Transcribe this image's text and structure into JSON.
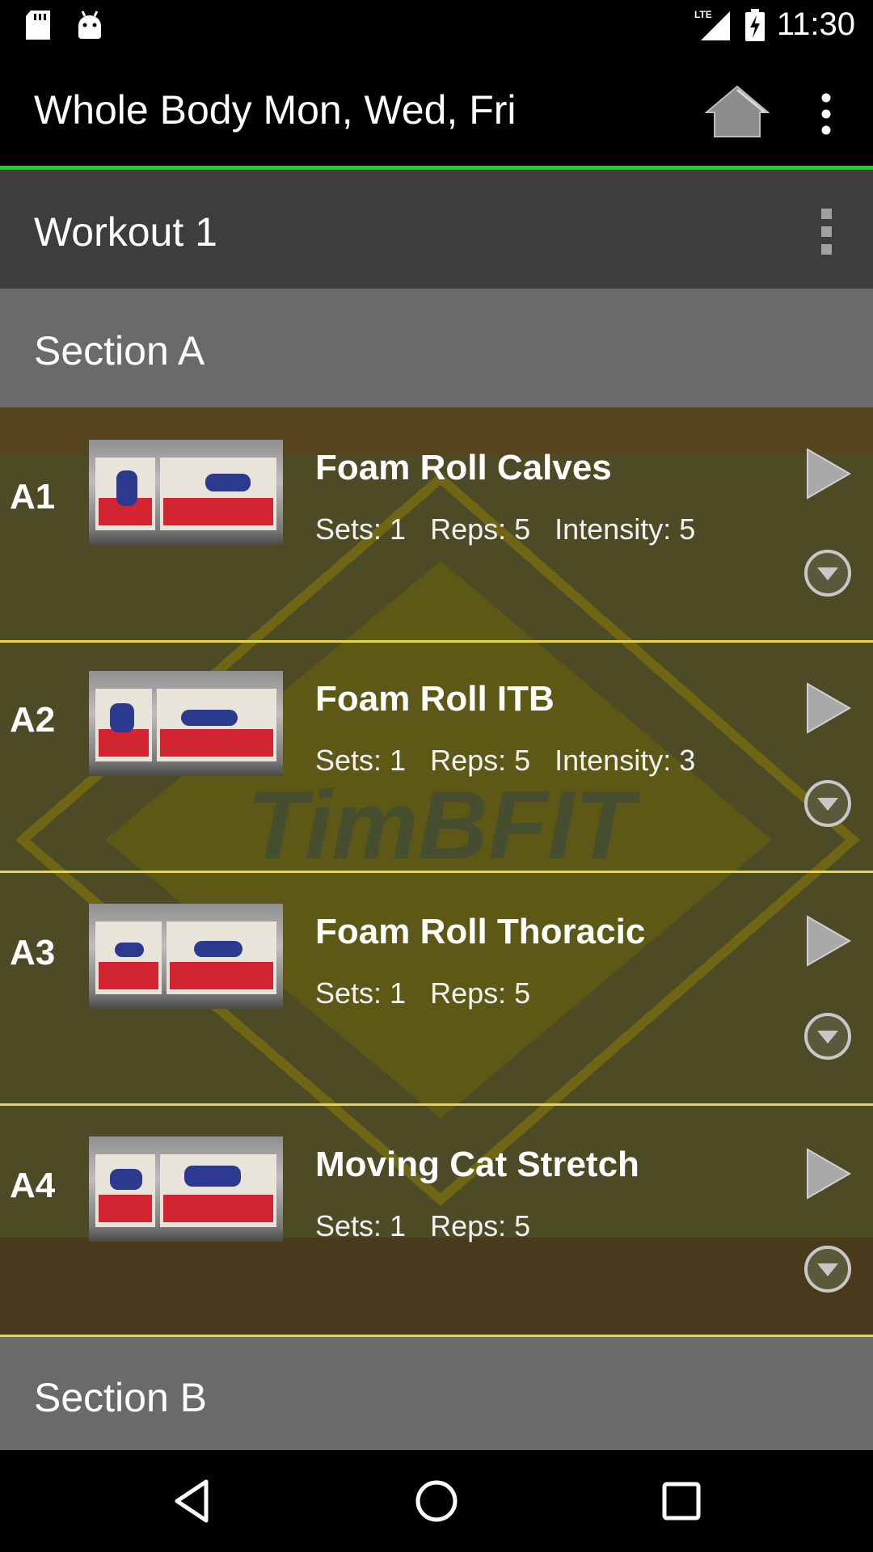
{
  "status_bar": {
    "time": "11:30",
    "network": "LTE",
    "icons": [
      "sd-card-icon",
      "android-icon",
      "lte-signal-icon",
      "battery-charging-icon"
    ]
  },
  "app_bar": {
    "title": "Whole Body Mon, Wed, Fri",
    "accent_color": "#11dd11"
  },
  "workout": {
    "title": "Workout 1"
  },
  "sections": [
    {
      "title": "Section A"
    },
    {
      "title": "Section B"
    }
  ],
  "watermark": {
    "text": "TimBFIT"
  },
  "exercises": [
    {
      "id": "A1",
      "name": "Foam Roll Calves",
      "stats": "Sets: 1   Reps: 5   Intensity: 5"
    },
    {
      "id": "A2",
      "name": "Foam Roll ITB",
      "stats": "Sets: 1   Reps: 5   Intensity: 3"
    },
    {
      "id": "A3",
      "name": "Foam Roll Thoracic",
      "stats": "Sets: 1   Reps: 5"
    },
    {
      "id": "A4",
      "name": "Moving Cat Stretch",
      "stats": "Sets: 1   Reps: 5"
    }
  ],
  "nav_bar": {
    "buttons": [
      "back-icon",
      "home-circle-icon",
      "recents-icon"
    ]
  }
}
